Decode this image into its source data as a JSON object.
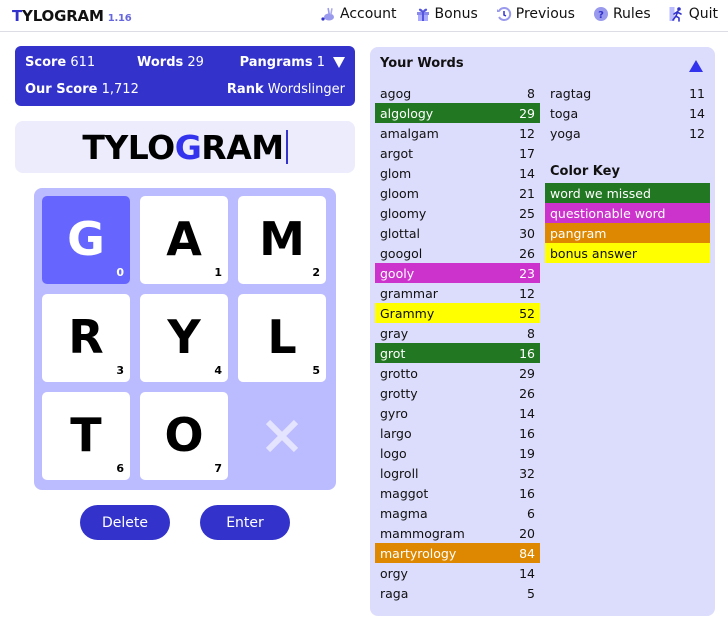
{
  "header": {
    "brand_first": "T",
    "brand_rest": "YLOGRAM",
    "version": "1.16",
    "nav": [
      {
        "label": "Account",
        "icon": "rabbit-icon"
      },
      {
        "label": "Bonus",
        "icon": "gift-icon"
      },
      {
        "label": "Previous",
        "icon": "history-icon"
      },
      {
        "label": "Rules",
        "icon": "question-icon"
      },
      {
        "label": "Quit",
        "icon": "running-person-icon"
      }
    ]
  },
  "score_panel": {
    "score_label": "Score",
    "score_value": "611",
    "words_label": "Words",
    "words_value": "29",
    "pangrams_label": "Pangrams",
    "pangrams_value": "1",
    "our_score_label": "Our Score",
    "our_score_value": "1,712",
    "rank_label": "Rank",
    "rank_value": "Wordslinger"
  },
  "entry": {
    "before": "TYLO",
    "highlight": "G",
    "after": "RAM"
  },
  "grid": {
    "tiles": [
      {
        "letter": "G",
        "index": "0",
        "selected": true
      },
      {
        "letter": "A",
        "index": "1",
        "selected": false
      },
      {
        "letter": "M",
        "index": "2",
        "selected": false
      },
      {
        "letter": "R",
        "index": "3",
        "selected": false
      },
      {
        "letter": "Y",
        "index": "4",
        "selected": false
      },
      {
        "letter": "L",
        "index": "5",
        "selected": false
      },
      {
        "letter": "T",
        "index": "6",
        "selected": false
      },
      {
        "letter": "O",
        "index": "7",
        "selected": false
      }
    ]
  },
  "buttons": {
    "delete": "Delete",
    "enter": "Enter"
  },
  "words_panel": {
    "title": "Your Words",
    "columns": [
      [
        {
          "word": "agog",
          "score": "8",
          "type": ""
        },
        {
          "word": "algology",
          "score": "29",
          "type": "missed"
        },
        {
          "word": "amalgam",
          "score": "12",
          "type": ""
        },
        {
          "word": "argot",
          "score": "17",
          "type": ""
        },
        {
          "word": "glom",
          "score": "14",
          "type": ""
        },
        {
          "word": "gloom",
          "score": "21",
          "type": ""
        },
        {
          "word": "gloomy",
          "score": "25",
          "type": ""
        },
        {
          "word": "glottal",
          "score": "30",
          "type": ""
        },
        {
          "word": "googol",
          "score": "26",
          "type": ""
        },
        {
          "word": "gooly",
          "score": "23",
          "type": "questionable"
        },
        {
          "word": "grammar",
          "score": "12",
          "type": ""
        },
        {
          "word": "Grammy",
          "score": "52",
          "type": "bonus"
        },
        {
          "word": "gray",
          "score": "8",
          "type": ""
        },
        {
          "word": "grot",
          "score": "16",
          "type": "missed"
        },
        {
          "word": "grotto",
          "score": "29",
          "type": ""
        },
        {
          "word": "grotty",
          "score": "26",
          "type": ""
        },
        {
          "word": "gyro",
          "score": "14",
          "type": ""
        },
        {
          "word": "largo",
          "score": "16",
          "type": ""
        },
        {
          "word": "logo",
          "score": "19",
          "type": ""
        },
        {
          "word": "logroll",
          "score": "32",
          "type": ""
        },
        {
          "word": "maggot",
          "score": "16",
          "type": ""
        },
        {
          "word": "magma",
          "score": "6",
          "type": ""
        },
        {
          "word": "mammogram",
          "score": "20",
          "type": ""
        },
        {
          "word": "martyrology",
          "score": "84",
          "type": "pangram"
        },
        {
          "word": "orgy",
          "score": "14",
          "type": ""
        },
        {
          "word": "raga",
          "score": "5",
          "type": ""
        }
      ],
      [
        {
          "word": "ragtag",
          "score": "11",
          "type": ""
        },
        {
          "word": "toga",
          "score": "14",
          "type": ""
        },
        {
          "word": "yoga",
          "score": "12",
          "type": ""
        }
      ]
    ],
    "color_key_title": "Color Key",
    "color_key": [
      {
        "label": "word we missed",
        "type": "missed",
        "color": "#227722"
      },
      {
        "label": "questionable word",
        "type": "questionable",
        "color": "#cc33cc"
      },
      {
        "label": "pangram",
        "type": "pangram",
        "color": "#dd8800"
      },
      {
        "label": "bonus answer",
        "type": "bonus",
        "color": "#ffff00"
      }
    ]
  },
  "colors": {
    "accent": "#3333cc",
    "selected_tile": "#6666ff",
    "grid_bg": "#bbbbff",
    "panel_bg": "#dcdcfc"
  }
}
